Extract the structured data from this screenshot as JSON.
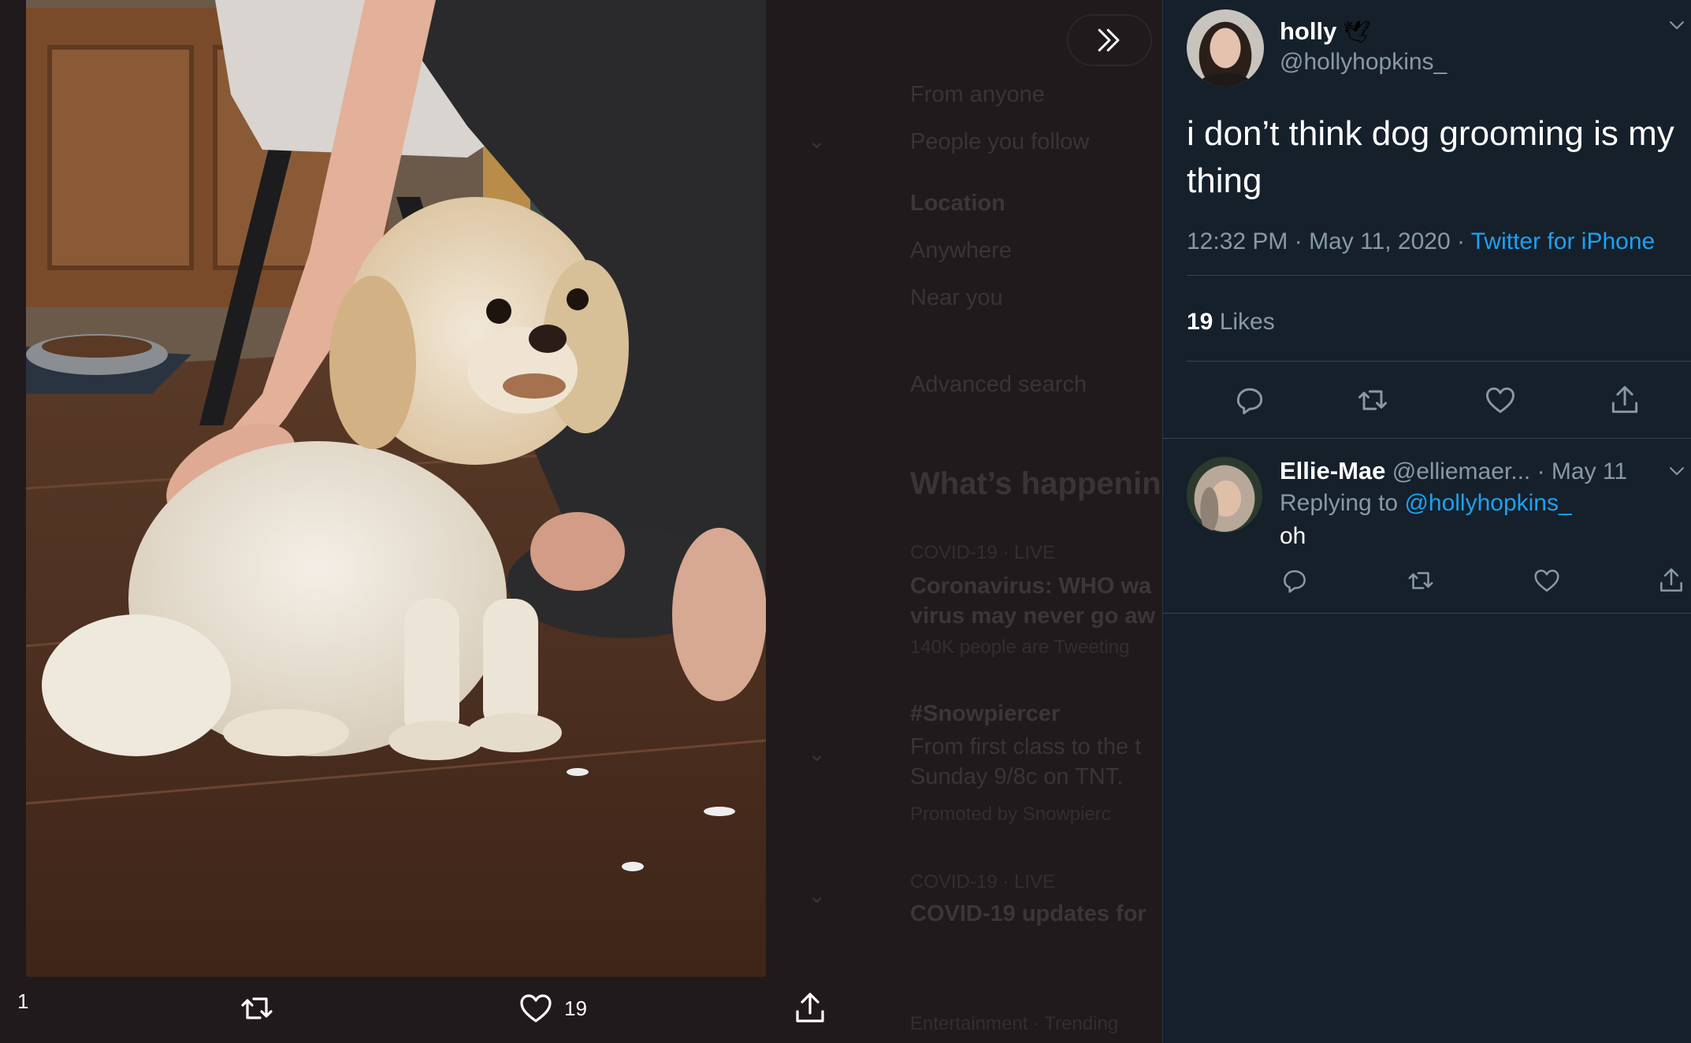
{
  "background_panel": {
    "filter_from_anyone": "From anyone",
    "filter_people_you_follow": "People you follow",
    "location_heading": "Location",
    "location_anywhere": "Anywhere",
    "location_near_you": "Near you",
    "advanced_search": "Advanced search",
    "whats_happening": "What’s happenin",
    "trend1_meta": "COVID-19 · LIVE",
    "trend1_line1": "Coronavirus: WHO wa",
    "trend1_line2": "virus may never go aw",
    "trend1_count": "140K people are Tweeting",
    "trend2_tag": "#Snowpiercer",
    "trend2_line1": "From first class to the t",
    "trend2_line2": "Sunday 9/8c on TNT.",
    "trend2_promoted": "Promoted by Snowpierc",
    "trend3_meta": "COVID-19 · LIVE",
    "trend3_title": "COVID-19 updates for",
    "trend4_meta": "Entertainment · Trending"
  },
  "media_actions": {
    "reply_count": "1",
    "like_count": "19"
  },
  "tweet": {
    "author_name": "holly",
    "author_handle": "@hollyhopkins_",
    "text": "i don’t think dog grooming is my thing",
    "time": "12:32 PM · May 11, 2020 · ",
    "source": "Twitter for iPhone",
    "likes_count": "19",
    "likes_label": " Likes"
  },
  "reply": {
    "author_name": "Ellie-Mae",
    "author_handle": "@elliemaer...",
    "date": " · May 11",
    "replying_prefix": "Replying to ",
    "replying_to": "@hollyhopkins_",
    "text": "oh"
  },
  "colors": {
    "panel_bg": "#15202b",
    "accent": "#1da1f2",
    "muted_text": "#8899a6"
  },
  "icons": [
    "collapse-panel-icon",
    "reply-icon",
    "retweet-icon",
    "like-icon",
    "share-icon",
    "chevron-down-icon",
    "dove-emoji"
  ]
}
